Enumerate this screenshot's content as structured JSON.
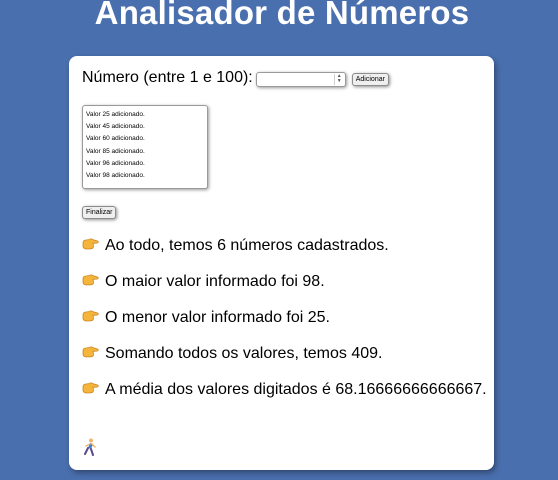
{
  "page": {
    "title": "Analisador de Números"
  },
  "form": {
    "number_label": "Número (entre 1 e 100):",
    "number_value": "",
    "add_button": "Adicionar",
    "finish_button": "Finalizar"
  },
  "list": {
    "items": [
      "Valor 25 adicionado.",
      "Valor 45 adicionado.",
      "Valor 60 adicionado.",
      "Valor 85 adicionado.",
      "Valor 96 adicionado.",
      "Valor 98 adicionado."
    ]
  },
  "results": {
    "total": "Ao todo, temos 6 números cadastrados.",
    "max": "O maior valor informado foi 98.",
    "min": "O menor valor informado foi 25.",
    "sum": "Somando todos os valores, temos 409.",
    "avg": "A média dos valores digitados é 68.16666666666667."
  },
  "icons": {
    "pointer": "backhand-index-pointing-right-icon",
    "footer": "running-person-icon"
  },
  "colors": {
    "background": "#4a6fae",
    "card": "#ffffff",
    "title": "#ffffff"
  }
}
